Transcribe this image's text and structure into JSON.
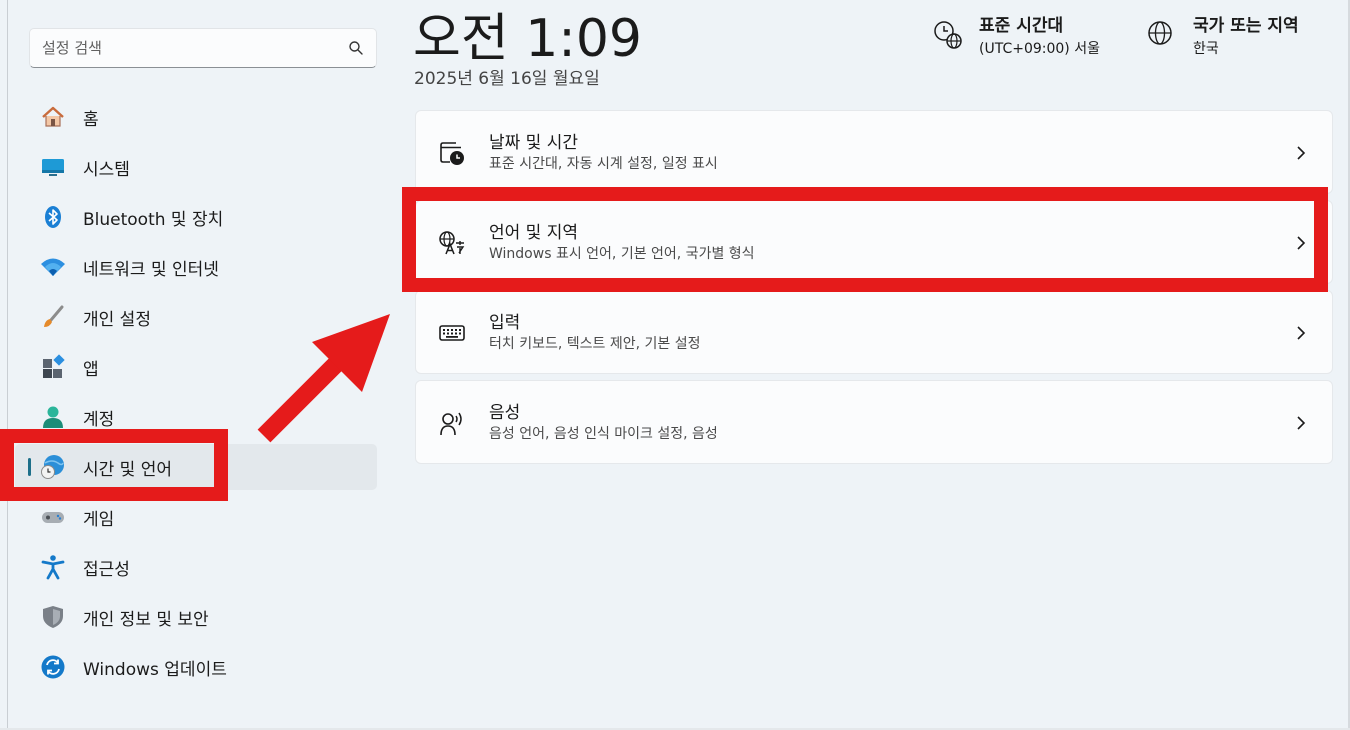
{
  "search": {
    "placeholder": "설정 검색",
    "icon": "search-icon"
  },
  "sidebar": {
    "items": [
      {
        "label": "홈",
        "icon": "home-icon"
      },
      {
        "label": "시스템",
        "icon": "system-icon"
      },
      {
        "label": "Bluetooth 및 장치",
        "icon": "bluetooth-icon"
      },
      {
        "label": "네트워크 및 인터넷",
        "icon": "wifi-icon"
      },
      {
        "label": "개인 설정",
        "icon": "brush-icon"
      },
      {
        "label": "앱",
        "icon": "apps-icon"
      },
      {
        "label": "계정",
        "icon": "account-icon"
      },
      {
        "label": "시간 및 언어",
        "icon": "time-language-icon",
        "active": true
      },
      {
        "label": "게임",
        "icon": "gamepad-icon"
      },
      {
        "label": "접근성",
        "icon": "accessibility-icon"
      },
      {
        "label": "개인 정보 및 보안",
        "icon": "shield-icon"
      },
      {
        "label": "Windows 업데이트",
        "icon": "update-icon"
      }
    ]
  },
  "header": {
    "time": "오전 1:09",
    "date": "2025년 6월 16일 월요일",
    "timezone": {
      "title": "표준 시간대",
      "value": "(UTC+09:00) 서울",
      "icon": "clock-globe-icon"
    },
    "region": {
      "title": "국가 또는 지역",
      "value": "한국",
      "icon": "globe-icon"
    }
  },
  "cards": [
    {
      "title": "날짜 및 시간",
      "subtitle": "표준 시간대, 자동 시계 설정, 일정 표시",
      "icon": "calendar-clock-icon"
    },
    {
      "title": "언어 및 지역",
      "subtitle": "Windows 표시 언어, 기본 언어, 국가별 형식",
      "icon": "language-icon"
    },
    {
      "title": "입력",
      "subtitle": "터치 키보드, 텍스트 제안, 기본 설정",
      "icon": "keyboard-icon"
    },
    {
      "title": "음성",
      "subtitle": "음성 언어, 음성 인식 마이크 설정, 음성",
      "icon": "speech-icon"
    }
  ],
  "colors": {
    "accent": "#1d6f8a",
    "highlight": "#e51b1b",
    "background": "#eef3f7",
    "card": "#fbfcfd"
  }
}
